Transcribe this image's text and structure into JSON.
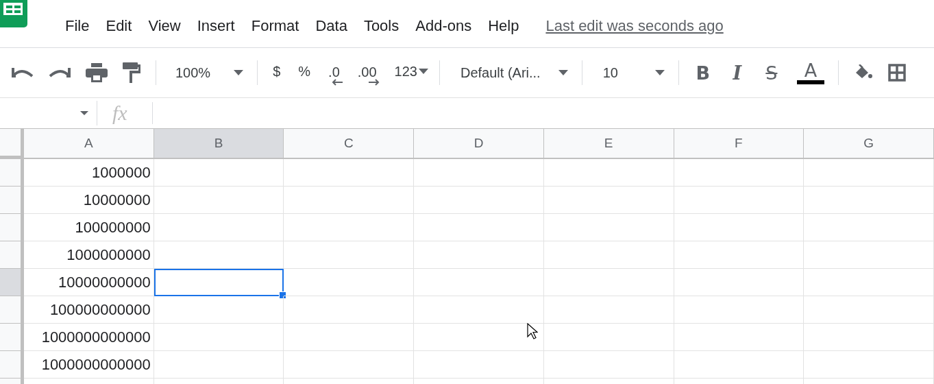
{
  "menu": {
    "items": [
      "File",
      "Edit",
      "View",
      "Insert",
      "Format",
      "Data",
      "Tools",
      "Add-ons",
      "Help"
    ],
    "last_edit": "Last edit was seconds ago"
  },
  "toolbar": {
    "zoom": "100%",
    "currency": "$",
    "percent": "%",
    "decrease_decimals": ".0",
    "increase_decimals": ".00",
    "more_formats": "123",
    "font": "Default (Ari...",
    "font_size": "10",
    "bold": "B",
    "italic": "I",
    "strikethrough": "S",
    "text_color": "A"
  },
  "formula_bar": {
    "fx": "fx"
  },
  "columns": [
    {
      "label": "A",
      "selected": false
    },
    {
      "label": "B",
      "selected": true
    },
    {
      "label": "C",
      "selected": false
    },
    {
      "label": "D",
      "selected": false
    },
    {
      "label": "E",
      "selected": false
    },
    {
      "label": "F",
      "selected": false
    },
    {
      "label": "G",
      "selected": false
    }
  ],
  "rows": [
    {
      "selected": false,
      "cells": [
        {
          "text": "1000000",
          "selected": false
        },
        {
          "selected": false
        },
        {
          "selected": false
        },
        {
          "selected": false
        },
        {
          "selected": false
        },
        {
          "selected": false
        },
        {
          "selected": false
        }
      ]
    },
    {
      "selected": false,
      "cells": [
        {
          "text": "10000000",
          "selected": false
        },
        {
          "selected": false
        },
        {
          "selected": false
        },
        {
          "selected": false
        },
        {
          "selected": false
        },
        {
          "selected": false
        },
        {
          "selected": false
        }
      ]
    },
    {
      "selected": false,
      "cells": [
        {
          "text": "100000000",
          "selected": false
        },
        {
          "selected": false
        },
        {
          "selected": false
        },
        {
          "selected": false
        },
        {
          "selected": false
        },
        {
          "selected": false
        },
        {
          "selected": false
        }
      ]
    },
    {
      "selected": false,
      "cells": [
        {
          "text": "1000000000",
          "selected": false
        },
        {
          "selected": false
        },
        {
          "selected": false
        },
        {
          "selected": false
        },
        {
          "selected": false
        },
        {
          "selected": false
        },
        {
          "selected": false
        }
      ]
    },
    {
      "selected": true,
      "cells": [
        {
          "text": "10000000000",
          "selected": false
        },
        {
          "selected": true
        },
        {
          "selected": false
        },
        {
          "selected": false
        },
        {
          "selected": false
        },
        {
          "selected": false
        },
        {
          "selected": false
        }
      ]
    },
    {
      "selected": false,
      "cells": [
        {
          "text": "100000000000",
          "selected": false
        },
        {
          "selected": false
        },
        {
          "selected": false
        },
        {
          "selected": false
        },
        {
          "selected": false
        },
        {
          "selected": false
        },
        {
          "selected": false
        }
      ]
    },
    {
      "selected": false,
      "cells": [
        {
          "text": "1000000000000",
          "selected": false
        },
        {
          "selected": false
        },
        {
          "selected": false
        },
        {
          "selected": false
        },
        {
          "selected": false
        },
        {
          "selected": false
        },
        {
          "selected": false
        }
      ]
    },
    {
      "selected": false,
      "cells": [
        {
          "text": "1000000000000",
          "selected": false
        },
        {
          "selected": false
        },
        {
          "selected": false
        },
        {
          "selected": false
        },
        {
          "selected": false
        },
        {
          "selected": false
        },
        {
          "selected": false
        }
      ]
    }
  ]
}
